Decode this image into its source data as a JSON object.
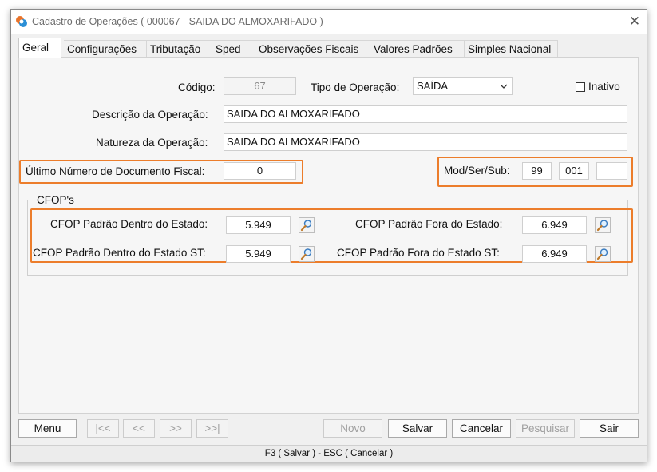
{
  "window": {
    "title": "Cadastro de Operações ( 000067 - SAIDA DO ALMOXARIFADO )",
    "close_symbol": "✕"
  },
  "tabs": [
    {
      "label": "Geral"
    },
    {
      "label": "Configurações"
    },
    {
      "label": "Tributação"
    },
    {
      "label": "Sped"
    },
    {
      "label": "Observações Fiscais"
    },
    {
      "label": "Valores Padrões"
    },
    {
      "label": "Simples Nacional"
    }
  ],
  "form": {
    "codigo_label": "Código:",
    "codigo_value": "67",
    "tipo_operacao_label": "Tipo de Operação:",
    "tipo_operacao_value": "SAÍDA",
    "inativo_label": "Inativo",
    "inativo_checked": false,
    "descricao_label": "Descrição da Operação:",
    "descricao_value": "SAIDA DO ALMOXARIFADO",
    "natureza_label": "Natureza da Operação:",
    "natureza_value": "SAIDA DO ALMOXARIFADO",
    "ultimo_numero_label": "Último Número de Documento Fiscal:",
    "ultimo_numero_value": "0",
    "mod_ser_sub_label": "Mod/Ser/Sub:",
    "mod_value": "99",
    "ser_value": "001",
    "sub_value": ""
  },
  "cfop": {
    "group_title": "CFOP's",
    "dentro_estado_label": "CFOP Padrão Dentro do Estado:",
    "dentro_estado_value": "5.949",
    "fora_estado_label": "CFOP Padrão Fora do Estado:",
    "fora_estado_value": "6.949",
    "dentro_estado_st_label": "CFOP Padrão Dentro do Estado ST:",
    "dentro_estado_st_value": "5.949",
    "fora_estado_st_label": "CFOP Padrão Fora do Estado ST:",
    "fora_estado_st_value": "6.949"
  },
  "buttons": {
    "menu": "Menu",
    "first": "|<<",
    "prev": "<<",
    "next": ">>",
    "last": ">>|",
    "novo": "Novo",
    "salvar": "Salvar",
    "cancelar": "Cancelar",
    "pesquisar": "Pesquisar",
    "sair": "Sair"
  },
  "status_bar": "F3 ( Salvar )  -  ESC ( Cancelar )",
  "icons": {
    "app": "app-icon",
    "lookup": "magnifier-icon",
    "dropdown": "chevron-down-icon"
  },
  "colors": {
    "highlight": "#ec7d2b"
  }
}
